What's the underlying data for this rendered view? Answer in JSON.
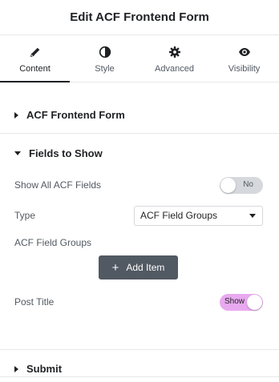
{
  "header": {
    "title": "Edit ACF Frontend Form"
  },
  "tabs": [
    {
      "label": "Content",
      "icon": "pencil-icon",
      "active": true
    },
    {
      "label": "Style",
      "icon": "half-circle-icon",
      "active": false
    },
    {
      "label": "Advanced",
      "icon": "gear-icon",
      "active": false
    },
    {
      "label": "Visibility",
      "icon": "eye-icon",
      "active": false
    }
  ],
  "sections": {
    "form": {
      "title": "ACF Frontend Form",
      "expanded": false
    },
    "fields": {
      "title": "Fields to Show",
      "expanded": true
    },
    "submit": {
      "title": "Submit",
      "expanded": false
    }
  },
  "controls": {
    "show_all": {
      "label": "Show All ACF Fields",
      "toggle_text": "No",
      "value": false
    },
    "type": {
      "label": "Type",
      "value": "ACF Field Groups"
    },
    "field_groups": {
      "label": "ACF Field Groups",
      "add_label": "Add Item"
    },
    "post_title": {
      "label": "Post Title",
      "toggle_text": "Show",
      "value": true
    }
  },
  "colors": {
    "accent": "#e9a9f0",
    "button": "#515962",
    "text": "#1f2124",
    "muted": "#515962"
  }
}
